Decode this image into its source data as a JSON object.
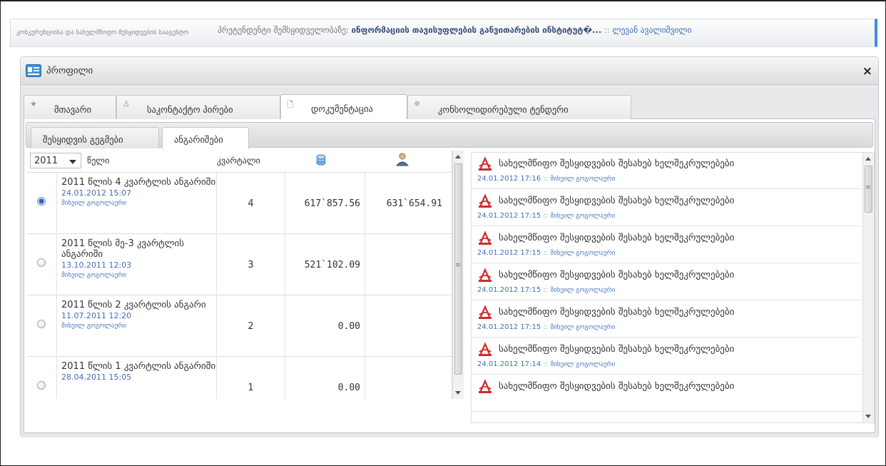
{
  "header": {
    "left_text": "კონკურენციისა და სახელმწიფო შესყიდვების სააგენტო",
    "breadcrumb_prefix": "პრეტენდენტი შემსყიდველობაზე:",
    "institution": "ინფორმაციის თავისუფლების განვითარების ინსტიტუტ�...",
    "separator": "::",
    "user": "ლევან ავალიშვილი"
  },
  "dialog": {
    "title": "პროფილი",
    "close_label": "×",
    "tabs": [
      {
        "label": "მთავარი",
        "icon": "star-icon"
      },
      {
        "label": "საკონტაქტო პირები",
        "icon": "person-icon"
      },
      {
        "label": "დოკუმენტაცია",
        "icon": "document-icon"
      },
      {
        "label": "კონსოლიდირებული ტენდერი",
        "icon": "gear-icon"
      }
    ],
    "active_tab": 2,
    "subtabs": [
      {
        "label": "შესყიდვის გეგმები"
      },
      {
        "label": "ანგარიშები"
      }
    ],
    "active_subtab": 1
  },
  "reports": {
    "year_value": "2011",
    "year_label": "წელი",
    "quarter_header": "კვარტალი",
    "rows": [
      {
        "title": "2011 წლის 4 კვარტლის ანგარიში",
        "date": "24.01.2012 15:07",
        "user": "მიხეილ გოგოლაური",
        "quarter": "4",
        "amount1": "617`857.56",
        "amount2": "631`654.91",
        "selected": true
      },
      {
        "title": "2011 წლის მე-3 კვარტლის ანგარიში",
        "date": "13.10.2011 12:03",
        "user": "მიხეილ გოგოლაური",
        "quarter": "3",
        "amount1": "521`102.09",
        "amount2": "",
        "selected": false
      },
      {
        "title": "2011 წლის 2 კვარტლის ანგარი",
        "date": "11.07.2011 12:20",
        "user": "მიხეილ გოგოლაური",
        "quarter": "2",
        "amount1": "0.00",
        "amount2": "",
        "selected": false
      },
      {
        "title": "2011 წლის 1 კვარტლის ანგარიში",
        "date": "28.04.2011 15:05",
        "user": "",
        "quarter": "1",
        "amount1": "0.00",
        "amount2": "",
        "selected": false
      }
    ]
  },
  "documents": [
    {
      "name": "სახელმწიფო შესყიდვების შესახებ ხელშეკრულებები",
      "date": "24.01.2012 17:16",
      "sep": "::",
      "user": "მიხეილ გოგოლაური"
    },
    {
      "name": "სახელმწიფო შესყიდვების შესახებ ხელშეკრულებები",
      "date": "24.01.2012 17:15",
      "sep": "::",
      "user": "მიხეილ გოგოლაური"
    },
    {
      "name": "სახელმწიფო შესყიდვების შესახებ ხელშეკრულებები",
      "date": "24.01.2012 17:15",
      "sep": "::",
      "user": "მიხეილ გოგოლაური"
    },
    {
      "name": "სახელმწიფო შესყიდვების შესახებ ხელშეკრულებები",
      "date": "24.01.2012 17:15",
      "sep": "::",
      "user": "მიხეილ გოგოლაური"
    },
    {
      "name": "სახელმწიფო შესყიდვების შესახებ ხელშეკრულებები",
      "date": "24.01.2012 17:15",
      "sep": "::",
      "user": "მიხეილ გოგოლაური"
    },
    {
      "name": "სახელმწიფო შესყიდვების შესახებ ხელშეკრულებები",
      "date": "24.01.2012 17:14",
      "sep": "::",
      "user": "მიხეილ გოგოლაური"
    },
    {
      "name": "სახელმწიფო შესყიდვების შესახებ ხელშეკრულებები",
      "date": "",
      "sep": "",
      "user": ""
    }
  ],
  "colors": {
    "accent": "#3f6fb8",
    "pdf_red": "#d22b2b"
  }
}
